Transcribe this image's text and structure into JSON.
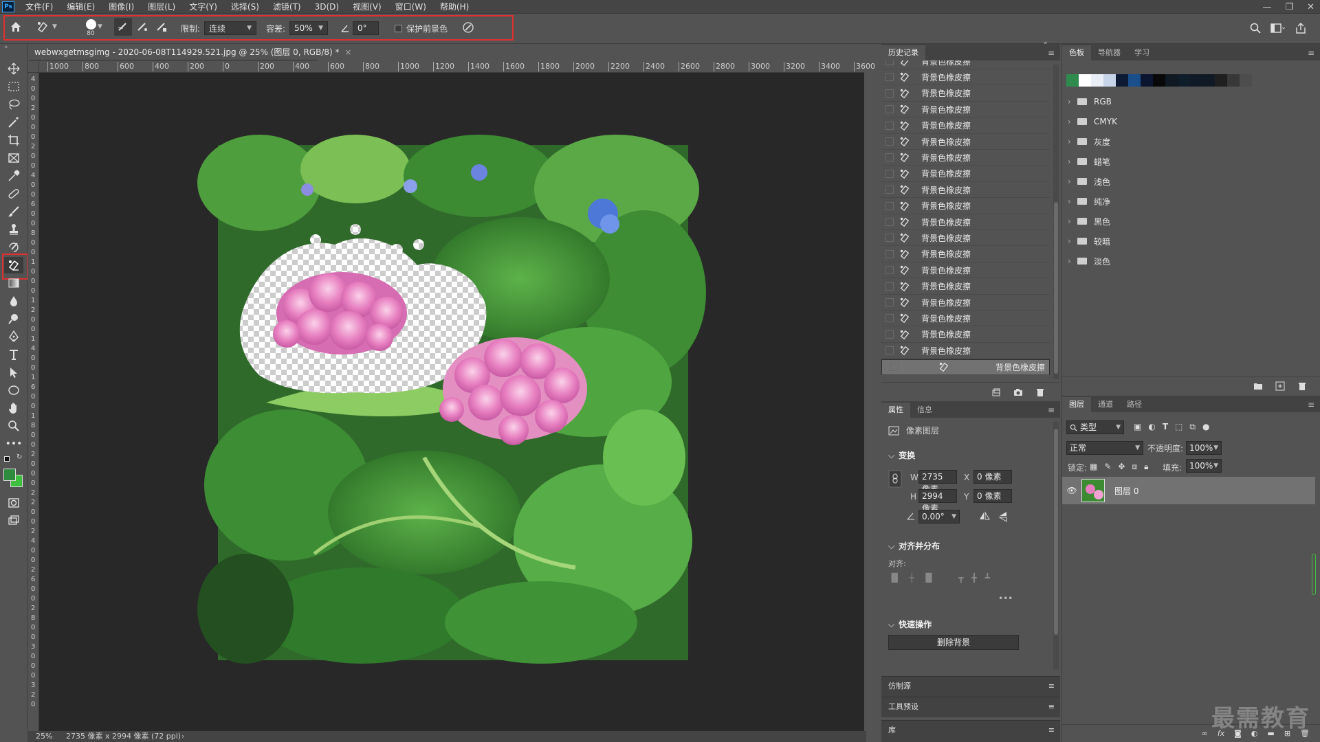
{
  "app": {
    "logo": "Ps"
  },
  "menu": [
    "文件(F)",
    "编辑(E)",
    "图像(I)",
    "图层(L)",
    "文字(Y)",
    "选择(S)",
    "滤镜(T)",
    "3D(D)",
    "视图(V)",
    "窗口(W)",
    "帮助(H)"
  ],
  "options": {
    "brush_size": "80",
    "limit_label": "限制:",
    "limit_value": "连续",
    "tolerance_label": "容差:",
    "tolerance_value": "50%",
    "angle_value": "0°",
    "protect_fg_label": "保护前景色",
    "protect_fg_checked": false
  },
  "document": {
    "tab_title": "webwxgetmsgimg - 2020-06-08T114929.521.jpg @ 25% (图层 0, RGB/8) *",
    "ruler_ticks": [
      "1000",
      "800",
      "600",
      "400",
      "200",
      "0",
      "200",
      "400",
      "600",
      "800",
      "1000",
      "1200",
      "1400",
      "1600",
      "1800",
      "2000",
      "2200",
      "2400",
      "2600",
      "2800",
      "3000",
      "3200",
      "3400",
      "3600"
    ],
    "ruler_left_digits": [
      "4",
      "0",
      "0",
      "2",
      "0",
      "0",
      "0",
      "2",
      "0",
      "0",
      "4",
      "0",
      "0",
      "6",
      "0",
      "0",
      "8",
      "0",
      "0",
      "1",
      "0",
      "0",
      "0",
      "1",
      "2",
      "0",
      "0",
      "1",
      "4",
      "0",
      "0",
      "1",
      "6",
      "0",
      "0",
      "1",
      "8",
      "0",
      "0",
      "2",
      "0",
      "0",
      "0",
      "2",
      "2",
      "0",
      "0",
      "2",
      "4",
      "0",
      "0",
      "2",
      "6",
      "0",
      "0",
      "2",
      "8",
      "0",
      "0",
      "3",
      "0",
      "0",
      "0",
      "3",
      "2",
      "0"
    ]
  },
  "status": {
    "zoom": "25%",
    "doc_info": "2735 像素 x 2994 像素 (72 ppi)"
  },
  "history": {
    "tabs": [
      "历史记录"
    ],
    "item_label": "背景色橡皮擦",
    "item_count": 20,
    "selected_index": 19
  },
  "swatches": {
    "tabs": [
      "色板",
      "导航器",
      "学习"
    ],
    "recent_colors": [
      "#2f8a4e",
      "#ffffff",
      "#e9edf5",
      "#c7d3e8",
      "#0d1a33",
      "#1b4f8c",
      "#0b1530",
      "#080808",
      "#101821",
      "#0f1d2b",
      "#101a26",
      "#111a24",
      "#1f1f1f",
      "#383838",
      "#4d4d4d"
    ],
    "folders": [
      "RGB",
      "CMYK",
      "灰度",
      "蜡笔",
      "浅色",
      "纯净",
      "黑色",
      "较暗",
      "淡色"
    ]
  },
  "properties": {
    "tabs": [
      "属性",
      "信息"
    ],
    "layer_type": "像素图层",
    "transform_title": "变换",
    "w_label": "W",
    "w_value": "2735 像素",
    "h_label": "H",
    "h_value": "2994 像素",
    "x_label": "X",
    "x_value": "0 像素",
    "y_label": "Y",
    "y_value": "0 像素",
    "angle_value": "0.00°",
    "align_title": "对齐并分布",
    "align_label": "对齐:",
    "quick_title": "快速操作",
    "remove_bg_label": "删除背景"
  },
  "collapsed_panels": [
    "仿制源",
    "工具预设",
    "库"
  ],
  "layers": {
    "tabs": [
      "图层",
      "通道",
      "路径"
    ],
    "filter_label": "类型",
    "blend_mode": "正常",
    "opacity_label": "不透明度:",
    "opacity_value": "100%",
    "lock_label": "锁定:",
    "fill_label": "填充:",
    "fill_value": "100%",
    "layer_name": "图层 0",
    "layer_visible": true
  },
  "watermark": "最需教育",
  "colors": {
    "foreground": "#2e8b3e",
    "background": "#3fbf3f",
    "highlight": "#e03030"
  }
}
